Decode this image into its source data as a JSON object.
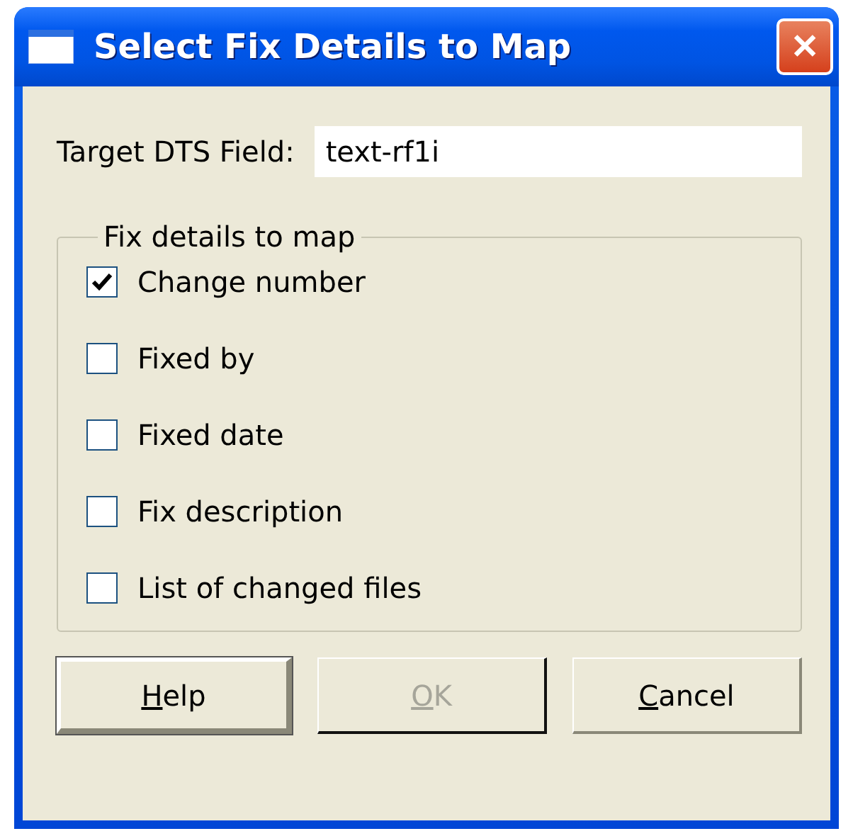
{
  "window": {
    "title": "Select Fix Details to Map",
    "close": "✕"
  },
  "target_field": {
    "label": "Target DTS Field:",
    "value": "text-rf1i"
  },
  "group": {
    "title": "Fix details to map",
    "options": [
      {
        "label": "Change number",
        "checked": true
      },
      {
        "label": "Fixed by",
        "checked": false
      },
      {
        "label": "Fixed date",
        "checked": false
      },
      {
        "label": "Fix description",
        "checked": false
      },
      {
        "label": "List of changed files",
        "checked": false
      }
    ]
  },
  "buttons": [
    {
      "access_key": "H",
      "rest": "elp",
      "default": true,
      "disabled": false
    },
    {
      "access_key": "O",
      "rest": "K",
      "default": false,
      "disabled": true
    },
    {
      "access_key": "C",
      "rest": "ancel",
      "default": false,
      "disabled": false
    }
  ]
}
